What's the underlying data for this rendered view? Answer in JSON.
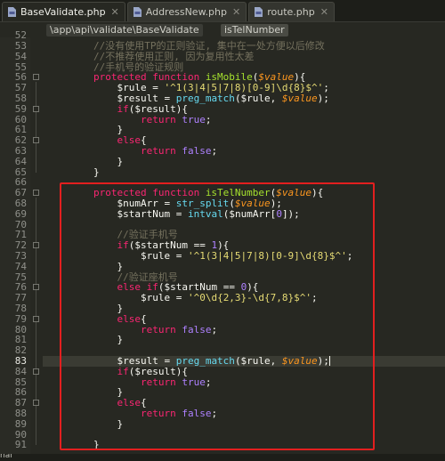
{
  "tabs": [
    {
      "label": "BaseValidate.php",
      "close": "✕",
      "active": true
    },
    {
      "label": "AddressNew.php",
      "close": "✕",
      "active": false
    },
    {
      "label": "route.php",
      "close": "✕",
      "active": false
    }
  ],
  "breadcrumb": {
    "path": "\\app\\api\\validate\\BaseValidate",
    "method": "isTelNumber"
  },
  "status": {
    "label": "nal"
  },
  "cursor_line": 83,
  "code_lines": [
    {
      "n": 53,
      "t": [
        [
          "cmt",
          "        //没有使用TP的正则验证, 集中在一处方便以后修改"
        ]
      ]
    },
    {
      "n": 54,
      "t": [
        [
          "cmt",
          "        //不推荐使用正则, 因为复用性太差"
        ]
      ]
    },
    {
      "n": 55,
      "t": [
        [
          "cmt",
          "        //手机号的验证规则"
        ]
      ]
    },
    {
      "n": 56,
      "t": [
        [
          "kw",
          "        protected function "
        ],
        [
          "fn",
          "isMobile"
        ],
        [
          "var",
          "("
        ],
        [
          "param",
          "$value"
        ],
        [
          "var",
          "){"
        ]
      ]
    },
    {
      "n": 57,
      "t": [
        [
          "var",
          "            $rule = "
        ],
        [
          "str",
          "'^1(3|4|5|7|8)[0-9]\\d{8}$^'"
        ],
        [
          "var",
          ";"
        ]
      ]
    },
    {
      "n": 58,
      "t": [
        [
          "var",
          "            $result = "
        ],
        [
          "const",
          "preg_match"
        ],
        [
          "var",
          "($rule, "
        ],
        [
          "param",
          "$value"
        ],
        [
          "var",
          ");"
        ]
      ]
    },
    {
      "n": 59,
      "t": [
        [
          "kw",
          "            if"
        ],
        [
          "var",
          "($result){"
        ]
      ]
    },
    {
      "n": 60,
      "t": [
        [
          "kw",
          "                return "
        ],
        [
          "num",
          "true"
        ],
        [
          "var",
          ";"
        ]
      ]
    },
    {
      "n": 61,
      "t": [
        [
          "var",
          "            }"
        ]
      ]
    },
    {
      "n": 62,
      "t": [
        [
          "kw",
          "            else"
        ],
        [
          "var",
          "{"
        ]
      ]
    },
    {
      "n": 63,
      "t": [
        [
          "kw",
          "                return "
        ],
        [
          "num",
          "false"
        ],
        [
          "var",
          ";"
        ]
      ]
    },
    {
      "n": 64,
      "t": [
        [
          "var",
          "            }"
        ]
      ]
    },
    {
      "n": 65,
      "t": [
        [
          "var",
          "        }"
        ]
      ]
    },
    {
      "n": 66,
      "t": []
    },
    {
      "n": 67,
      "t": [
        [
          "kw",
          "        protected function "
        ],
        [
          "fn",
          "isTelNumber"
        ],
        [
          "var",
          "("
        ],
        [
          "param",
          "$value"
        ],
        [
          "var",
          "){"
        ]
      ]
    },
    {
      "n": 68,
      "t": [
        [
          "var",
          "            $numArr = "
        ],
        [
          "const",
          "str_split"
        ],
        [
          "var",
          "("
        ],
        [
          "param",
          "$value"
        ],
        [
          "var",
          ");"
        ]
      ]
    },
    {
      "n": 69,
      "t": [
        [
          "var",
          "            $startNum = "
        ],
        [
          "const",
          "intval"
        ],
        [
          "var",
          "($numArr["
        ],
        [
          "num",
          "0"
        ],
        [
          "var",
          "]);"
        ]
      ]
    },
    {
      "n": 70,
      "t": []
    },
    {
      "n": 71,
      "t": [
        [
          "cmt",
          "            //验证手机号"
        ]
      ]
    },
    {
      "n": 72,
      "t": [
        [
          "kw",
          "            if"
        ],
        [
          "var",
          "($startNum == "
        ],
        [
          "num",
          "1"
        ],
        [
          "var",
          "){"
        ]
      ]
    },
    {
      "n": 73,
      "t": [
        [
          "var",
          "                $rule = "
        ],
        [
          "str",
          "'^1(3|4|5|7|8)[0-9]\\d{8}$^'"
        ],
        [
          "var",
          ";"
        ]
      ]
    },
    {
      "n": 74,
      "t": [
        [
          "var",
          "            }"
        ]
      ]
    },
    {
      "n": 75,
      "t": [
        [
          "cmt",
          "            //验证座机号"
        ]
      ]
    },
    {
      "n": 76,
      "t": [
        [
          "kw",
          "            else if"
        ],
        [
          "var",
          "($startNum == "
        ],
        [
          "num",
          "0"
        ],
        [
          "var",
          "){"
        ]
      ]
    },
    {
      "n": 77,
      "t": [
        [
          "var",
          "                $rule = "
        ],
        [
          "str",
          "'^0\\d{2,3}-\\d{7,8}$^'"
        ],
        [
          "var",
          ";"
        ]
      ]
    },
    {
      "n": 78,
      "t": [
        [
          "var",
          "            }"
        ]
      ]
    },
    {
      "n": 79,
      "t": [
        [
          "kw",
          "            else"
        ],
        [
          "var",
          "{"
        ]
      ]
    },
    {
      "n": 80,
      "t": [
        [
          "kw",
          "                return "
        ],
        [
          "num",
          "false"
        ],
        [
          "var",
          ";"
        ]
      ]
    },
    {
      "n": 81,
      "t": [
        [
          "var",
          "            }"
        ]
      ]
    },
    {
      "n": 82,
      "t": []
    },
    {
      "n": 83,
      "t": [
        [
          "var",
          "            $result = "
        ],
        [
          "const",
          "preg_match"
        ],
        [
          "var",
          "($rule, "
        ],
        [
          "param",
          "$value"
        ],
        [
          "var",
          ");"
        ]
      ]
    },
    {
      "n": 84,
      "t": [
        [
          "kw",
          "            if"
        ],
        [
          "var",
          "($result){"
        ]
      ]
    },
    {
      "n": 85,
      "t": [
        [
          "kw",
          "                return "
        ],
        [
          "num",
          "true"
        ],
        [
          "var",
          ";"
        ]
      ]
    },
    {
      "n": 86,
      "t": [
        [
          "var",
          "            }"
        ]
      ]
    },
    {
      "n": 87,
      "t": [
        [
          "kw",
          "            else"
        ],
        [
          "var",
          "{"
        ]
      ]
    },
    {
      "n": 88,
      "t": [
        [
          "kw",
          "                return "
        ],
        [
          "num",
          "false"
        ],
        [
          "var",
          ";"
        ]
      ]
    },
    {
      "n": 89,
      "t": [
        [
          "var",
          "            }"
        ]
      ]
    },
    {
      "n": 90,
      "t": []
    },
    {
      "n": 91,
      "t": [
        [
          "var",
          "        }"
        ]
      ]
    }
  ],
  "partial_line_number": "52",
  "theme": {
    "keyword": "#f92672",
    "function": "#a6e22e",
    "string": "#e6db74",
    "number": "#ae81ff",
    "builtin": "#66d9ef",
    "comment": "#75715e",
    "param": "#fd971f",
    "highlight_box": "#e21f1f"
  }
}
